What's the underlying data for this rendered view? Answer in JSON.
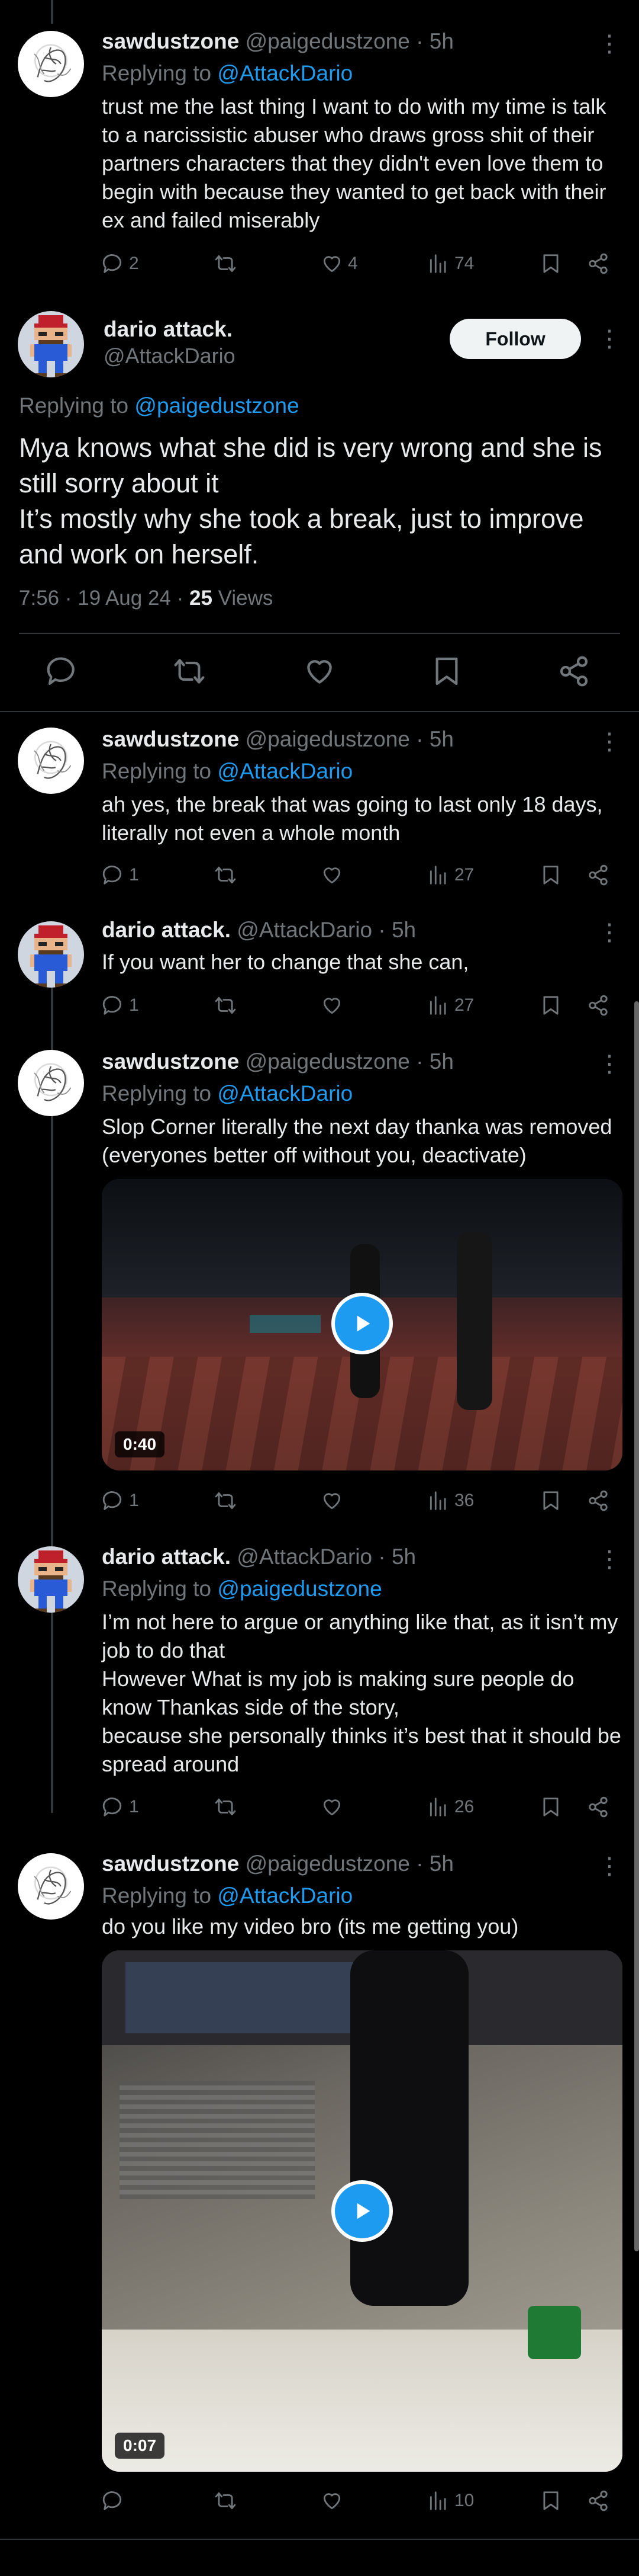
{
  "users": {
    "sawdust": {
      "name": "sawdustzone",
      "handle": "@paigedustzone"
    },
    "dario": {
      "name": "dario attack.",
      "handle": "@AttackDario"
    }
  },
  "common": {
    "dot": "·",
    "replying_prefix": "Replying to "
  },
  "post0": {
    "time": "5h",
    "replying_to": "@AttackDario",
    "text": "trust me the last thing I want to do with my time is talk to a narcissistic abuser who draws gross shit of their partners characters that they didn't even love them to begin with because they wanted to get back with their ex and failed miserably",
    "stats": {
      "replies": "2",
      "reposts": "",
      "likes": "4",
      "views": "74"
    }
  },
  "main": {
    "follow_label": "Follow",
    "replying_to": "@paigedustzone",
    "text": "Mya knows what she did is very wrong and she is still sorry about it\nIt’s mostly why she took a break, just to improve and work on herself.",
    "timestamp": "7:56 · 19 Aug 24 · ",
    "views_count": "25",
    "views_label": " Views"
  },
  "reply1": {
    "time": "5h",
    "replying_to": "@AttackDario",
    "text": "ah yes, the break that was going to last only 18 days, literally not even a whole month",
    "stats": {
      "replies": "1",
      "reposts": "",
      "likes": "",
      "views": "27"
    }
  },
  "reply2": {
    "time": "5h",
    "text": "If you want her to change that she can,",
    "stats": {
      "replies": "1",
      "reposts": "",
      "likes": "",
      "views": "27"
    }
  },
  "reply3": {
    "time": "5h",
    "replying_to": "@AttackDario",
    "text": "Slop Corner literally the next day thanka was removed (everyones better off without you, deactivate)",
    "video_duration": "0:40",
    "stats": {
      "replies": "1",
      "reposts": "",
      "likes": "",
      "views": "36"
    }
  },
  "reply4": {
    "time": "5h",
    "replying_to": "@paigedustzone",
    "text": "I’m not here to argue or anything like that, as it isn’t my job to do that\nHowever What is my job is making sure people do know Thankas side of the story,\nbecause she personally thinks it’s best that it should be spread around",
    "stats": {
      "replies": "1",
      "reposts": "",
      "likes": "",
      "views": "26"
    }
  },
  "reply5": {
    "time": "5h",
    "replying_to": "@AttackDario",
    "text": "do you like my video bro (its me getting you)",
    "video_duration": "0:07",
    "stats": {
      "replies": "",
      "reposts": "",
      "likes": "",
      "views": "10"
    }
  },
  "icons": {
    "reply": "reply-icon",
    "repost": "repost-icon",
    "like": "like-icon",
    "views": "views-icon",
    "bookmark": "bookmark-icon",
    "share": "share-icon",
    "more": "more-icon"
  },
  "colors": {
    "background": "#000000",
    "text": "#e7e9ea",
    "muted": "#71767b",
    "link": "#1d9bf0",
    "separator": "#2f3336"
  }
}
